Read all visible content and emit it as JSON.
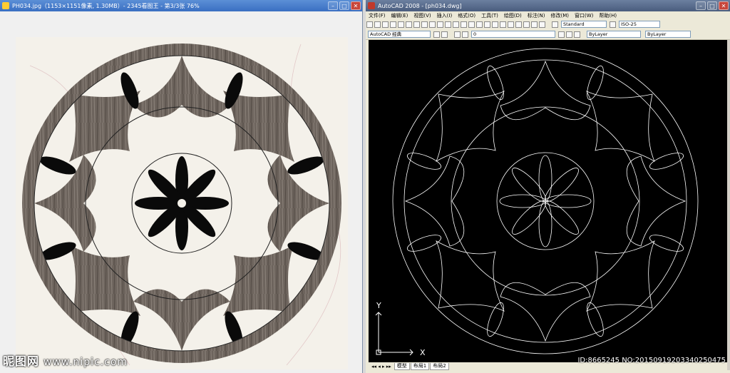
{
  "viewer": {
    "title": "PH034.jpg（1153×1151像素, 1.30MB）- 2345看图王 - 第3/3张 76%",
    "watermark": "昵图网",
    "watermark_url": "www.nipic.com"
  },
  "cad": {
    "title": "AutoCAD 2008 - [ph034.dwg]",
    "menu": [
      "文件(F)",
      "编辑(E)",
      "视图(V)",
      "插入(I)",
      "格式(O)",
      "工具(T)",
      "绘图(D)",
      "标注(N)",
      "修改(M)",
      "窗口(W)",
      "帮助(H)"
    ],
    "text_style": "Standard",
    "dim_style": "ISO-25",
    "workspace": "AutoCAD 经典",
    "layer": "0",
    "color": "ByLayer",
    "linetype": "ByLayer",
    "ucs_y": "Y",
    "ucs_x": "X",
    "tabs": [
      "模型",
      "布局1",
      "布局2"
    ]
  },
  "id_text": "ID:8665245 NO:20150919203340250475",
  "colors": {
    "marble_light": "#f4f1ea",
    "marble_dark": "#6b625b",
    "black": "#0a0a0a",
    "cad_line": "#ffffff"
  }
}
